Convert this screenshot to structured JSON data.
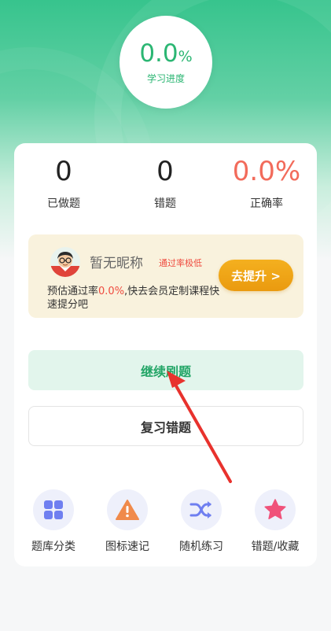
{
  "progress": {
    "value": "0.0",
    "unit": "%",
    "label": "学习进度"
  },
  "stats": [
    {
      "value": "0",
      "label": "已做题"
    },
    {
      "value": "0",
      "label": "错题"
    },
    {
      "value": "0.0%",
      "label": "正确率"
    }
  ],
  "member": {
    "nickname": "暂无昵称",
    "badge": "通过率极低",
    "pitch_prefix": "预估通过率",
    "pitch_rate": "0.0%",
    "pitch_suffix": ",快去会员定制课程快速提分吧",
    "upgrade_label": "去提升 >"
  },
  "actions": {
    "continue_label": "继续刷题",
    "review_label": "复习错题"
  },
  "quick_links": [
    {
      "label": "题库分类",
      "icon": "grid-icon"
    },
    {
      "label": "图标速记",
      "icon": "warning-icon"
    },
    {
      "label": "随机练习",
      "icon": "shuffle-icon"
    },
    {
      "label": "错题/收藏",
      "icon": "star-icon"
    }
  ],
  "colors": {
    "accent": "#2bb673",
    "danger": "#f26b5b",
    "upgrade": "#ef9f12",
    "arrow": "#e8322d"
  }
}
